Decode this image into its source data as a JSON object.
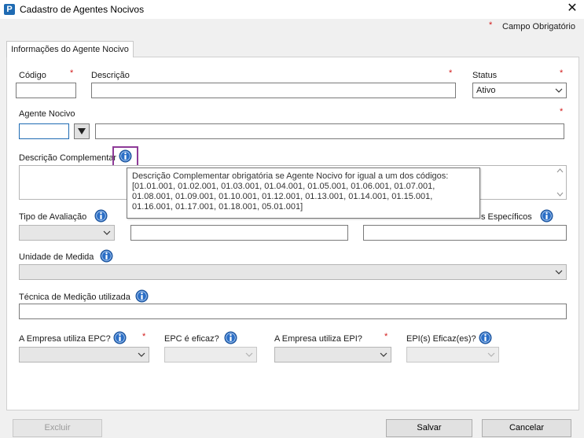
{
  "window": {
    "title": "Cadastro de Agentes Nocivos",
    "app_icon_letter": "P",
    "close_glyph": "✕"
  },
  "legend": {
    "star": "*",
    "text": "Campo Obrigatório"
  },
  "tab": {
    "label": "Informações do Agente Nocivo"
  },
  "fields": {
    "codigo": {
      "label": "Código",
      "value": ""
    },
    "descricao": {
      "label": "Descrição",
      "value": ""
    },
    "status": {
      "label": "Status",
      "value": "Ativo"
    },
    "agente_nocivo": {
      "label": "Agente Nocivo",
      "code_value": "",
      "desc_value": ""
    },
    "descricao_complementar": {
      "label": "Descrição Complementar",
      "value": ""
    },
    "tipo_avaliacao": {
      "label": "Tipo de Avaliação",
      "value": ""
    },
    "limites_especificos": {
      "label_partial": "s Específicos"
    },
    "unidade_medida": {
      "label": "Unidade de Medida",
      "value": ""
    },
    "tecnica_medicao": {
      "label": "Técnica de Medição utilizada",
      "value": ""
    },
    "empresa_epc": {
      "label": "A Empresa utiliza EPC?",
      "value": ""
    },
    "epc_eficaz": {
      "label": "EPC é eficaz?",
      "value": ""
    },
    "empresa_epi": {
      "label": "A Empresa utiliza EPI?",
      "value": ""
    },
    "epi_eficaz": {
      "label": "EPI(s) Eficaz(es)?",
      "value": ""
    }
  },
  "required_star": "*",
  "tooltip": {
    "lines": [
      "Descrição Complementar obrigatória se Agente Nocivo for igual a um dos códigos:",
      "[01.01.001, 01.02.001, 01.03.001, 01.04.001, 01.05.001, 01.06.001, 01.07.001,",
      " 01.08.001, 01.09.001, 01.10.001, 01.12.001, 01.13.001, 01.14.001, 01.15.001,",
      " 01.16.001, 01.17.001, 01.18.001, 05.01.001]"
    ]
  },
  "buttons": {
    "excluir": "Excluir",
    "salvar": "Salvar",
    "cancelar": "Cancelar"
  },
  "colors": {
    "accent": "#1f6bb3",
    "required": "#d21919",
    "highlight": "#8e3b98"
  }
}
